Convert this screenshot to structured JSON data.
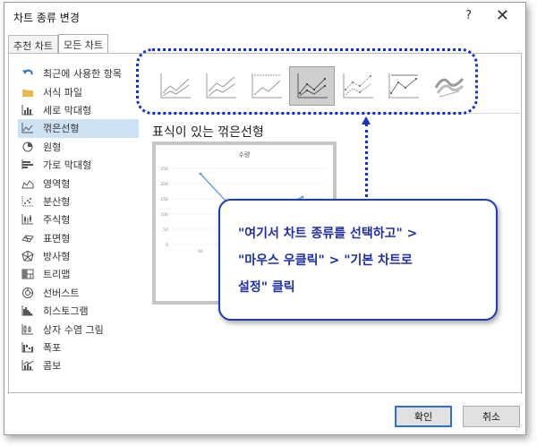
{
  "dialog": {
    "title": "차트 종류 변경",
    "help_label": "?",
    "close_label": "✕"
  },
  "tabs": [
    {
      "label": "추천 차트",
      "active": false
    },
    {
      "label": "모든 차트",
      "active": true
    }
  ],
  "chart_types": [
    {
      "label": "최근에 사용한 항목",
      "icon": "undo-icon"
    },
    {
      "label": "서식 파일",
      "icon": "folder-icon"
    },
    {
      "label": "세로 막대형",
      "icon": "column-chart-icon"
    },
    {
      "label": "꺾은선형",
      "icon": "line-chart-icon",
      "selected": true
    },
    {
      "label": "원형",
      "icon": "pie-chart-icon"
    },
    {
      "label": "가로 막대형",
      "icon": "bar-chart-icon"
    },
    {
      "label": "영역형",
      "icon": "area-chart-icon"
    },
    {
      "label": "분산형",
      "icon": "scatter-chart-icon"
    },
    {
      "label": "주식형",
      "icon": "stock-chart-icon"
    },
    {
      "label": "표면형",
      "icon": "surface-chart-icon"
    },
    {
      "label": "방사형",
      "icon": "radar-chart-icon"
    },
    {
      "label": "트리맵",
      "icon": "treemap-icon"
    },
    {
      "label": "선버스트",
      "icon": "sunburst-icon"
    },
    {
      "label": "히스토그램",
      "icon": "histogram-icon"
    },
    {
      "label": "상자 수염 그림",
      "icon": "box-whisker-icon"
    },
    {
      "label": "폭포",
      "icon": "waterfall-icon"
    },
    {
      "label": "콤보",
      "icon": "combo-chart-icon"
    }
  ],
  "subtypes": {
    "selected_index": 3,
    "selected_name": "표식이 있는 꺾은선형"
  },
  "preview": {
    "title": "수량",
    "y_ticks": [
      "250",
      "200",
      "150",
      "100",
      "50",
      "0"
    ],
    "x_label": "AA"
  },
  "callout": {
    "line1": "\"여기서 차트 종류를 선택하고\" >",
    "line2": "\"마우스 우클릭\" > \"기본 차트로",
    "line3": "설정\" 클릭"
  },
  "buttons": {
    "ok": "확인",
    "cancel": "취소"
  },
  "colors": {
    "callout_text": "#1f2fa0",
    "highlight_border": "#1430c8",
    "selection": "#cde2f3",
    "series_line": "#5b9bd5"
  }
}
